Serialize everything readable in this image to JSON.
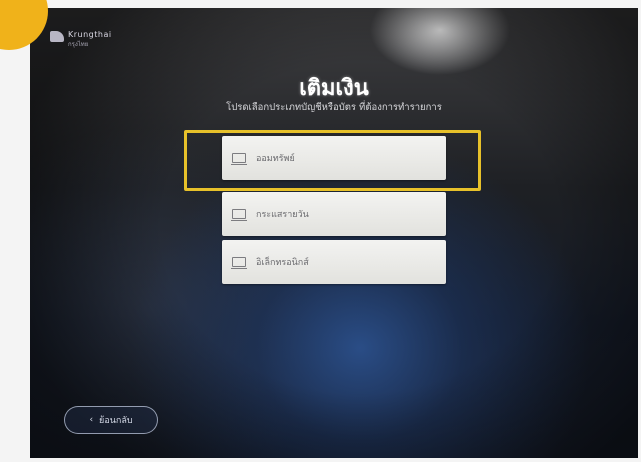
{
  "bank": {
    "name": "Krungthai",
    "sub": "กรุงไทย"
  },
  "screen": {
    "title": "เติมเงิน",
    "subtitle": "โปรดเลือกประเภทบัญชีหรือบัตร ที่ต้องการทำรายการ"
  },
  "options": [
    {
      "label": "ออมทรัพย์",
      "icon": "card-icon"
    },
    {
      "label": "กระแสรายวัน",
      "icon": "card-icon"
    },
    {
      "label": "อิเล็กทรอนิกส์",
      "icon": "card-icon"
    }
  ],
  "back": {
    "label": "ย้อนกลับ",
    "icon": "chevron-left-icon"
  },
  "colors": {
    "badge": "#f0b21a",
    "highlight": "#e7c12a",
    "option_bg": "#ececea"
  }
}
